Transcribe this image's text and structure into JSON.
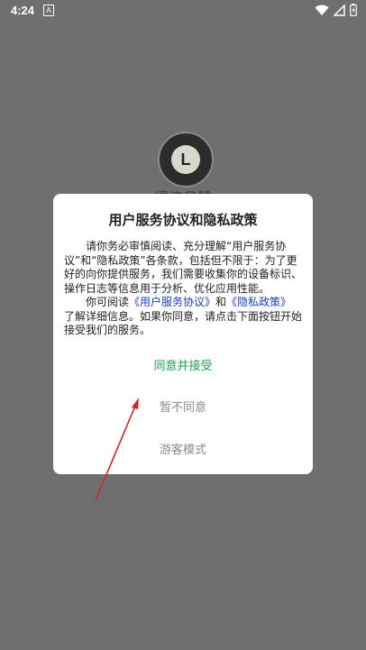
{
  "status_bar": {
    "time": "4:24",
    "notification_icon": "a-icon",
    "wifi_icon": "wifi-icon",
    "signal_icon": "signal-icon",
    "battery_icon": "battery-charging-icon"
  },
  "app": {
    "logo_letter": "L",
    "name": "得流日赞"
  },
  "dialog": {
    "title": "用户服务协议和隐私政策",
    "paragraph1": "请你务必审慎阅读、充分理解“用户服务协议”和“隐私政策”各条款，包括但不限于：为了更好的向你提供服务，我们需要收集你的设备标识、操作日志等信息用于分析、优化应用性能。",
    "p2_prefix": "你可阅读",
    "link_service": "《用户服务协议》",
    "p2_and": "和",
    "link_privacy": "《隐私政策》",
    "p2_suffix": "了解详细信息。如果你同意，请点击下面按钮开始接受我们的服务。",
    "accept_label": "同意并接受",
    "decline_label": "暂不同意",
    "guest_label": "游客模式"
  },
  "colors": {
    "overlay": "#6f6f6f",
    "accept": "#1aa34a",
    "link": "#1a3cd6",
    "arrow": "#e02020"
  }
}
